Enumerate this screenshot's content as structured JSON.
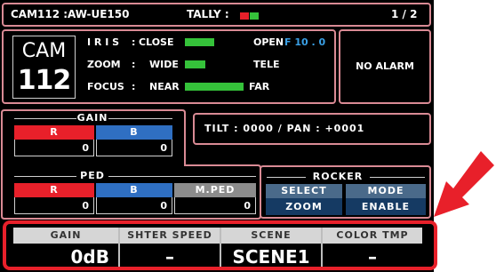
{
  "header": {
    "camera": "CAM112 :AW-UE150",
    "tally_label": "TALLY :",
    "page": "1 / 2"
  },
  "cam_id": {
    "label": "CAM",
    "number": "112"
  },
  "lens": {
    "iris": {
      "label": "I R I S",
      "sep": ":",
      "left": "CLOSE",
      "right": "OPEN",
      "value": "F 10 . 0"
    },
    "zoom": {
      "label": "ZOOM",
      "sep": ":",
      "left": "WIDE",
      "right": "TELE"
    },
    "focus": {
      "label": "FOCUS",
      "sep": ":",
      "left": "NEAR",
      "right": "FAR"
    }
  },
  "alarm": "NO ALARM",
  "tilt_pan": "TILT :  0000  /  PAN : +0001",
  "gain": {
    "title": "GAIN",
    "r": {
      "label": "R",
      "value": "0"
    },
    "b": {
      "label": "B",
      "value": "0"
    }
  },
  "ped": {
    "title": "PED",
    "r": {
      "label": "R",
      "value": "0"
    },
    "b": {
      "label": "B",
      "value": "0"
    },
    "m": {
      "label": "M.PED",
      "value": "0"
    }
  },
  "rocker": {
    "title": "ROCKER",
    "select_label": "SELECT",
    "select_value": "ZOOM",
    "mode_label": "MODE",
    "mode_value": "ENABLE"
  },
  "footer": {
    "headers": [
      "GAIN",
      "SHTER SPEED",
      "SCENE",
      "COLOR TMP"
    ],
    "values": [
      "0dB",
      "–",
      "SCENE1",
      "–"
    ]
  },
  "colors": {
    "red": "#e8202a",
    "blue": "#2f6fc2",
    "grey": "#8c8c8c",
    "navy": "#153a63",
    "green": "#35c23a",
    "accent": "#e8202a"
  },
  "icons": {
    "callout": "arrow-icon"
  }
}
